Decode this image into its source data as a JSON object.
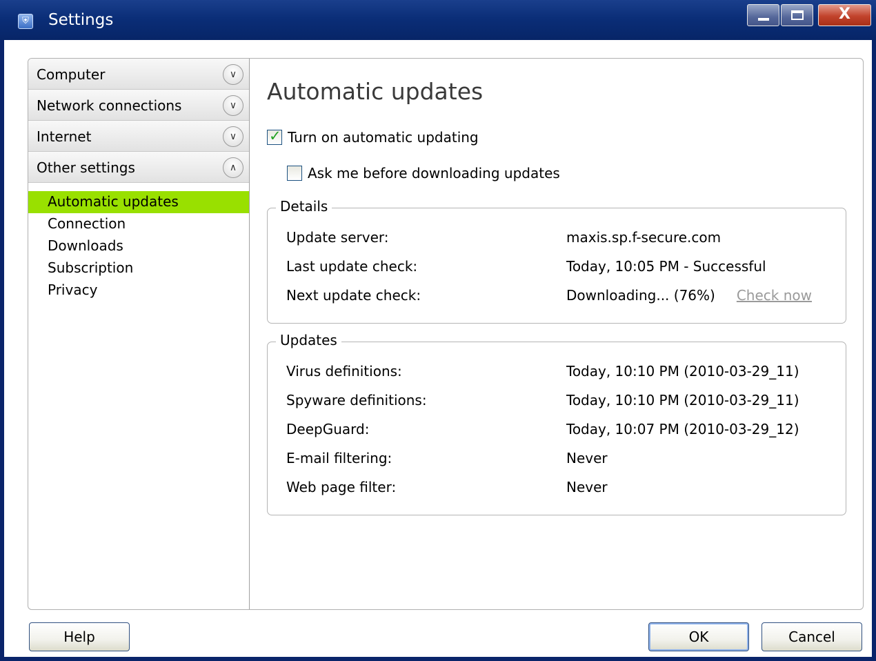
{
  "window": {
    "title": "Settings"
  },
  "titlebar": {
    "close_glyph": "X"
  },
  "sidebar": {
    "categories": [
      {
        "label": "Computer",
        "state": "collapsed"
      },
      {
        "label": "Network connections",
        "state": "collapsed"
      },
      {
        "label": "Internet",
        "state": "collapsed"
      },
      {
        "label": "Other settings",
        "state": "expanded"
      }
    ],
    "subitems": [
      "Automatic updates",
      "Connection",
      "Downloads",
      "Subscription",
      "Privacy"
    ],
    "active_subitem": "Automatic updates"
  },
  "main": {
    "heading": "Automatic updates",
    "auto_update": {
      "label": "Turn on automatic updating",
      "checked": true
    },
    "ask_me": {
      "label": "Ask me before downloading updates",
      "checked": false
    },
    "details": {
      "legend": "Details",
      "rows": [
        {
          "key": "Update server:",
          "value": "maxis.sp.f-secure.com"
        },
        {
          "key": "Last update check:",
          "value": "Today, 10:05 PM - Successful"
        },
        {
          "key": "Next update check:",
          "value": "Downloading... (76%)"
        }
      ],
      "check_now": "Check now"
    },
    "updates": {
      "legend": "Updates",
      "rows": [
        {
          "key": "Virus definitions:",
          "value": "Today, 10:10 PM (2010-03-29_11)"
        },
        {
          "key": "Spyware definitions:",
          "value": "Today, 10:10 PM (2010-03-29_11)"
        },
        {
          "key": "DeepGuard:",
          "value": "Today, 10:07 PM (2010-03-29_12)"
        },
        {
          "key": "E-mail filtering:",
          "value": "Never"
        },
        {
          "key": "Web page filter:",
          "value": "Never"
        }
      ]
    }
  },
  "footer": {
    "help": "Help",
    "ok": "OK",
    "cancel": "Cancel"
  },
  "colors": {
    "accent_selected": "#99e000",
    "titlebar": "#0b2e78",
    "check_tick": "#21a121"
  }
}
